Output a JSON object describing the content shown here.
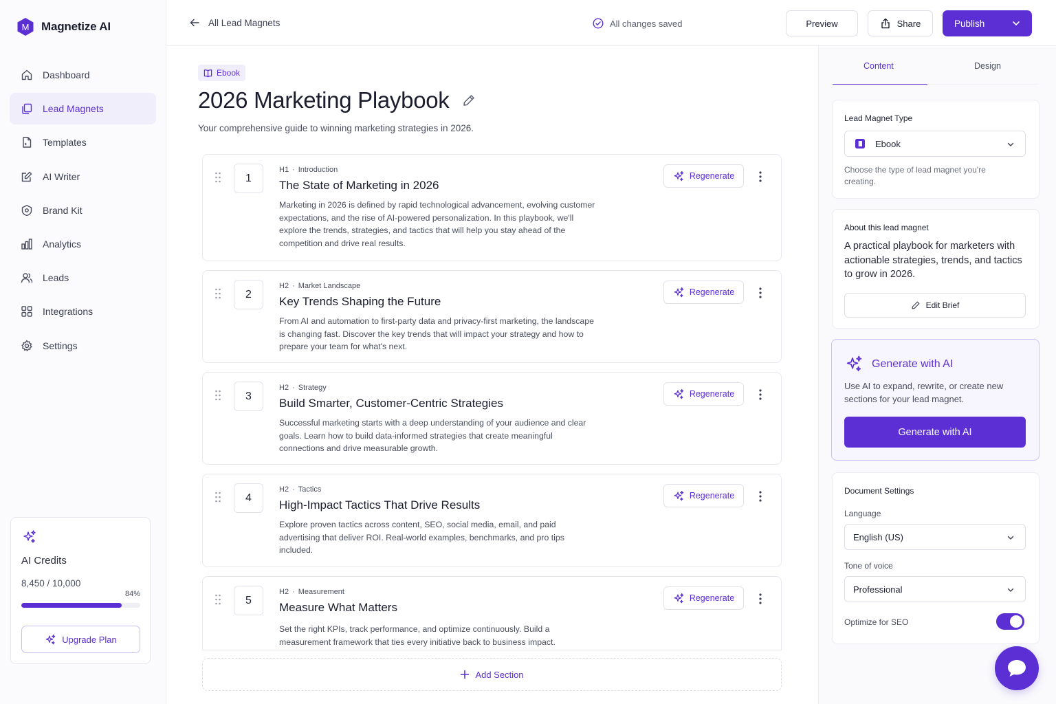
{
  "app": {
    "name": "Magnetize AI",
    "logo_letter": "M"
  },
  "colors": {
    "accent": "#5b2fd4",
    "accent_soft": "#f1eefc"
  },
  "sidebar": {
    "items": [
      {
        "label": "Dashboard",
        "icon": "home-icon"
      },
      {
        "label": "Lead Magnets",
        "icon": "copy-icon",
        "active": true
      },
      {
        "label": "Templates",
        "icon": "document-icon"
      },
      {
        "label": "AI Writer",
        "icon": "edit-icon"
      },
      {
        "label": "Brand Kit",
        "icon": "badge-icon"
      },
      {
        "label": "Analytics",
        "icon": "bar-chart-icon"
      },
      {
        "label": "Leads",
        "icon": "users-icon"
      },
      {
        "label": "Integrations",
        "icon": "grid-icon"
      },
      {
        "label": "Settings",
        "icon": "gear-icon"
      }
    ],
    "credits": {
      "title": "AI Credits",
      "count": "8,450 / 10,000",
      "percent_label": "84%",
      "fraction": 0.845,
      "upgrade_label": "Upgrade Plan"
    }
  },
  "topbar": {
    "back_label": "All Lead Magnets",
    "status": "All changes saved",
    "preview_label": "Preview",
    "share_label": "Share",
    "publish_label": "Publish"
  },
  "document": {
    "badge": "Ebook",
    "title": "2026 Marketing Playbook",
    "subtitle": "Your comprehensive guide to winning marketing strategies in 2026.",
    "regenerate_label": "Regenerate",
    "add_section_label": "Add Section",
    "sections": [
      {
        "number": "1",
        "level": "H1",
        "tag": "Introduction",
        "title": "The State of Marketing in 2026",
        "body": "Marketing in 2026 is defined by rapid technological advancement, evolving customer expectations, and the rise of AI-powered personalization. In this playbook, we'll explore the trends, strategies, and tactics that will help you stay ahead of the competition and drive real results."
      },
      {
        "number": "2",
        "level": "H2",
        "tag": "Market Landscape",
        "title": "Key Trends Shaping the Future",
        "body": "From AI and automation to first-party data and privacy-first marketing, the landscape is changing fast. Discover the key trends that will impact your strategy and how to prepare your team for what's next."
      },
      {
        "number": "3",
        "level": "H2",
        "tag": "Strategy",
        "title": "Build Smarter, Customer-Centric Strategies",
        "body": "Successful marketing starts with a deep understanding of your audience and clear goals. Learn how to build data-informed strategies that create meaningful connections and drive measurable growth."
      },
      {
        "number": "4",
        "level": "H2",
        "tag": "Tactics",
        "title": "High-Impact Tactics That Drive Results",
        "body": "Explore proven tactics across content, SEO, social media, email, and paid advertising that deliver ROI. Real-world examples, benchmarks, and pro tips included."
      },
      {
        "number": "5",
        "level": "H2",
        "tag": "Measurement",
        "title": "Measure What Matters",
        "body": "Set the right KPIs, track performance, and optimize continuously. Build a measurement framework that ties every initiative back to business impact."
      }
    ]
  },
  "panel": {
    "tabs": [
      "Content",
      "Design"
    ],
    "type_card": {
      "label": "Lead Magnet Type",
      "value": "Ebook",
      "help": "Choose the type of lead magnet you're creating."
    },
    "about_card": {
      "label": "About this lead magnet",
      "text": "A practical playbook for marketers with actionable strategies, trends, and tactics to grow in 2026.",
      "edit_label": "Edit Brief"
    },
    "ai_card": {
      "title": "Generate with AI",
      "desc": "Use AI to expand, rewrite, or create new sections for your lead magnet.",
      "button": "Generate with AI"
    },
    "settings_card": {
      "label": "Document Settings",
      "language_label": "Language",
      "language_value": "English (US)",
      "tone_label": "Tone of voice",
      "tone_value": "Professional",
      "seo_label": "Optimize for SEO",
      "seo_enabled": true
    }
  }
}
